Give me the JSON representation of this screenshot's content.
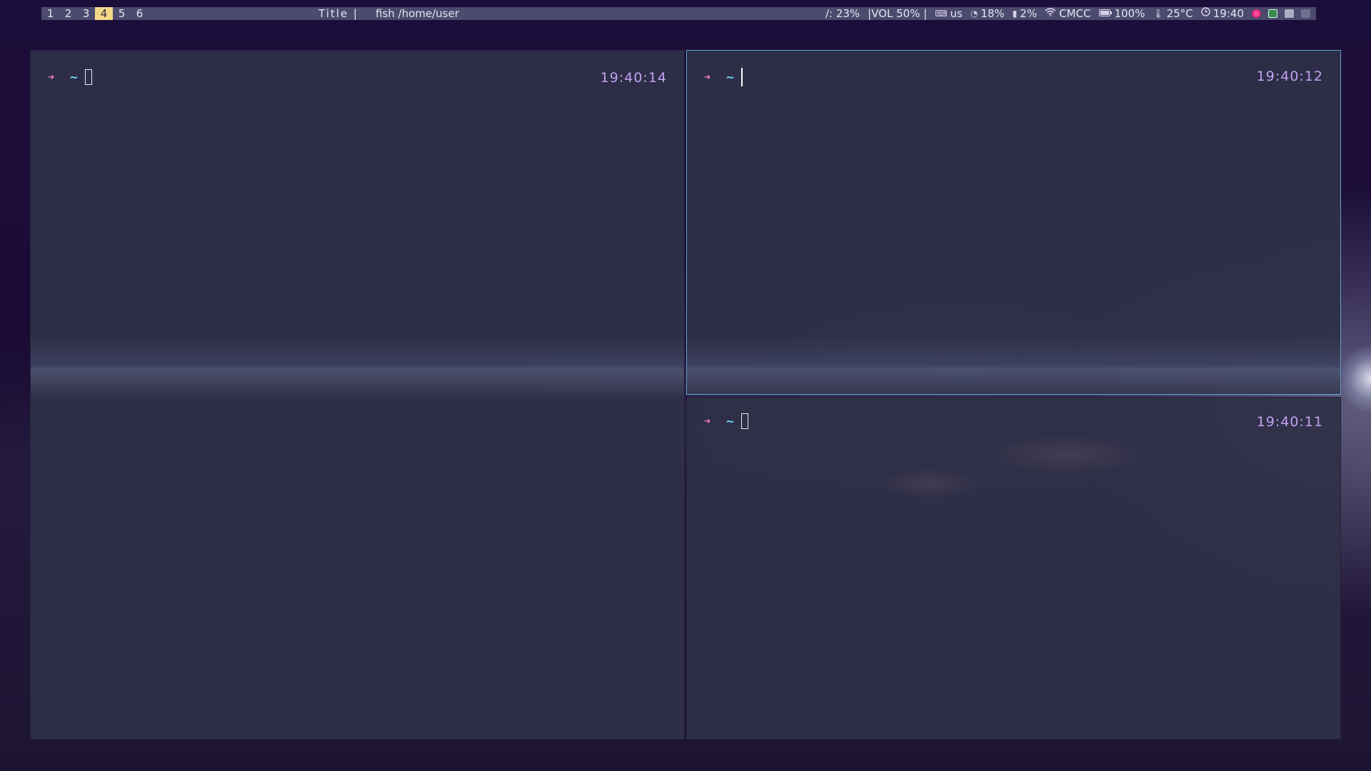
{
  "bar": {
    "workspaces": [
      "1",
      "2",
      "3",
      "4",
      "5",
      "6"
    ],
    "active_workspace": "4",
    "title": "Title |",
    "window_title": "fish /home/user",
    "disk": "/: 23%",
    "volume": "|VOL 50% |",
    "keyboard": "us",
    "cpu": "18%",
    "memory": "2%",
    "network": "CMCC",
    "battery": "100%",
    "temperature": "25°C",
    "clock": "19:40",
    "icons": {
      "keyboard": "keyboard-icon",
      "cpu": "cpu-pie-icon",
      "memory": "memory-icon",
      "network": "wifi-icon",
      "battery": "battery-icon",
      "temperature": "thermometer-icon",
      "clock": "clock-icon"
    },
    "colors": {
      "bar_bg": "#4c4a6e",
      "active_ws": "#f5d886"
    }
  },
  "terminals": [
    {
      "prompt_symbol": "➜",
      "dir": "~",
      "time": "19:40:14"
    },
    {
      "prompt_symbol": "➜",
      "dir": "~",
      "time": "19:40:12"
    },
    {
      "prompt_symbol": "➜",
      "dir": "~",
      "time": "19:40:11"
    }
  ],
  "colors": {
    "terminal_bg": "#30304a",
    "focus_border": "#5aa6c8",
    "prompt_arrow": "#f07ad0",
    "prompt_dir": "#69d6f2",
    "clock_text": "#c0a2f0"
  }
}
